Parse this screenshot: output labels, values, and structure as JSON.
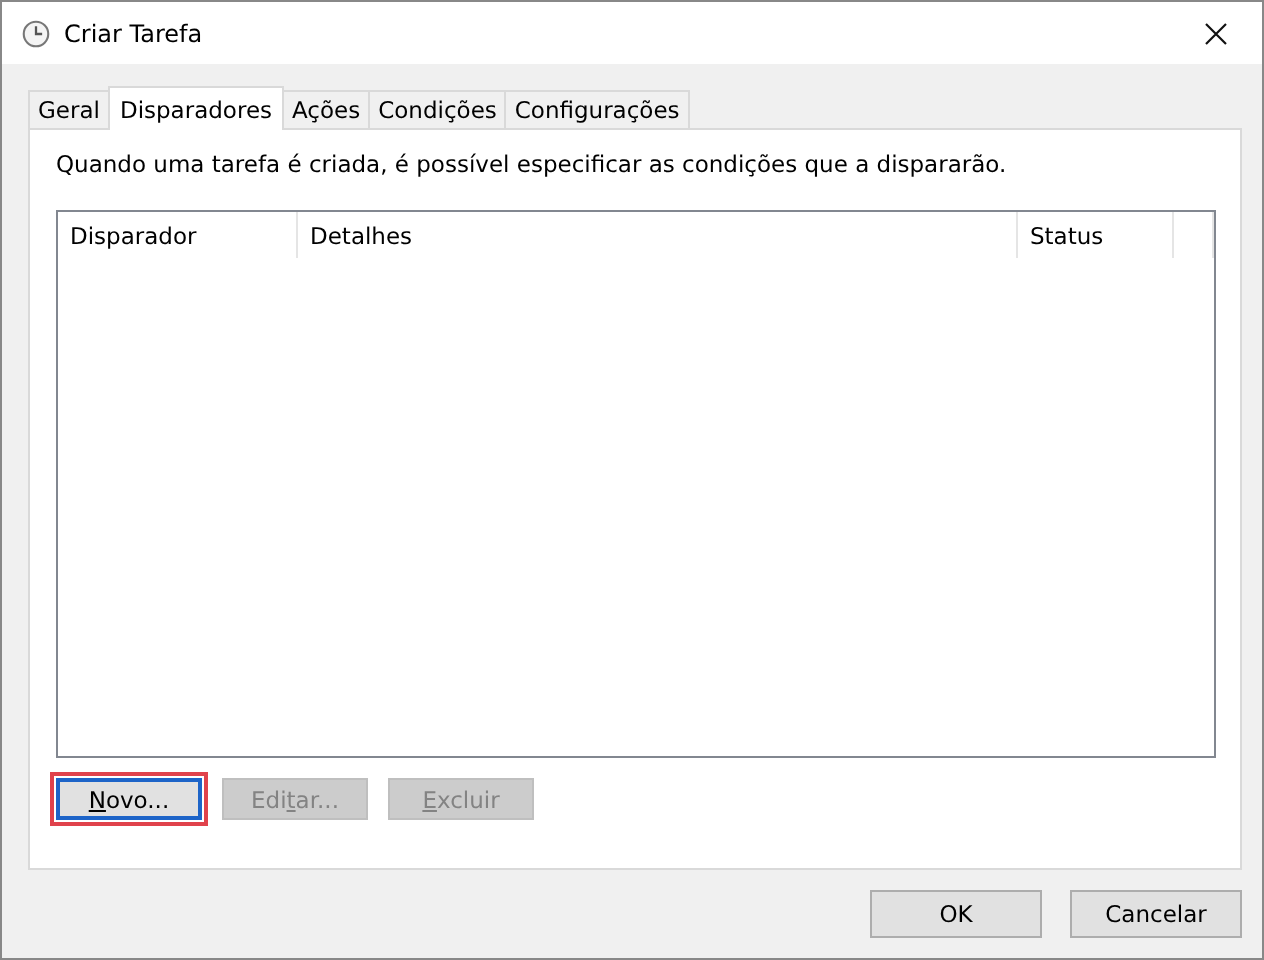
{
  "window": {
    "title": "Criar Tarefa"
  },
  "tabs": [
    {
      "label": "Geral",
      "selected": false
    },
    {
      "label": "Disparadores",
      "selected": true
    },
    {
      "label": "Ações",
      "selected": false
    },
    {
      "label": "Condições",
      "selected": false
    },
    {
      "label": "Configurações",
      "selected": false
    }
  ],
  "description": "Quando uma tarefa é criada, é possível especificar as condições que a dispararão.",
  "table": {
    "columns": [
      "Disparador",
      "Detalhes",
      "Status"
    ]
  },
  "list_buttons": [
    {
      "access_key": "N",
      "label_after": "ovo...",
      "disabled": false,
      "highlighted": true
    },
    {
      "label_before": "Edi",
      "access_key": "t",
      "label_after": "ar...",
      "disabled": true,
      "highlighted": false
    },
    {
      "access_key": "E",
      "label_after": "xcluir",
      "disabled": true,
      "highlighted": false
    }
  ],
  "dialog_buttons": [
    "OK",
    "Cancelar"
  ]
}
